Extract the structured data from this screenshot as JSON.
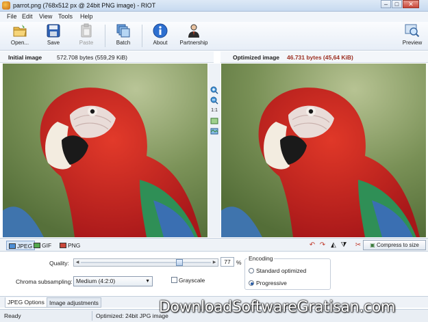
{
  "window": {
    "title": "parrot.png (768x512 px @ 24bit PNG image) - RIOT",
    "controls": {
      "minimize": "–",
      "maximize": "□",
      "close": "✕"
    }
  },
  "menu": {
    "items": [
      "File",
      "Edit",
      "View",
      "Tools",
      "Help"
    ]
  },
  "toolbar": {
    "open": "Open...",
    "save": "Save",
    "paste": "Paste",
    "batch": "Batch",
    "about": "About",
    "partnership": "Partnership",
    "preview": "Preview"
  },
  "panels": {
    "initial_label": "Initial image",
    "initial_size": "572.708 bytes (559,29 KiB)",
    "optimized_label": "Optimized image",
    "optimized_size": "46.731 bytes (45,64 KiB)"
  },
  "zoom_tools": {
    "one_to_one": "1:1"
  },
  "format_tabs": {
    "jpeg": "JPEG",
    "gif": "GIF",
    "png": "PNG"
  },
  "compress_button": "Compress to size",
  "options": {
    "quality_label": "Quality:",
    "quality_value": "77",
    "quality_fraction": 0.77,
    "quality_unit": "%",
    "chroma_label": "Chroma subsampling:",
    "chroma_value": "Medium (4:2:0)",
    "grayscale_label": "Grayscale",
    "encoding_label": "Encoding",
    "encoding_standard": "Standard optimized",
    "encoding_progressive": "Progressive",
    "encoding_selected": "Progressive"
  },
  "bottom_tabs": {
    "jpeg_options": "JPEG Options",
    "image_adjustments": "Image adjustments"
  },
  "status": {
    "ready": "Ready",
    "info": "Optimized: 24bit JPG image"
  },
  "watermark": "DownloadSoftwareGratisan.com",
  "colors": {
    "accent": "#2a5da8",
    "optimized_size": "#9b2d1f",
    "parrot_red": "#c8231b"
  }
}
